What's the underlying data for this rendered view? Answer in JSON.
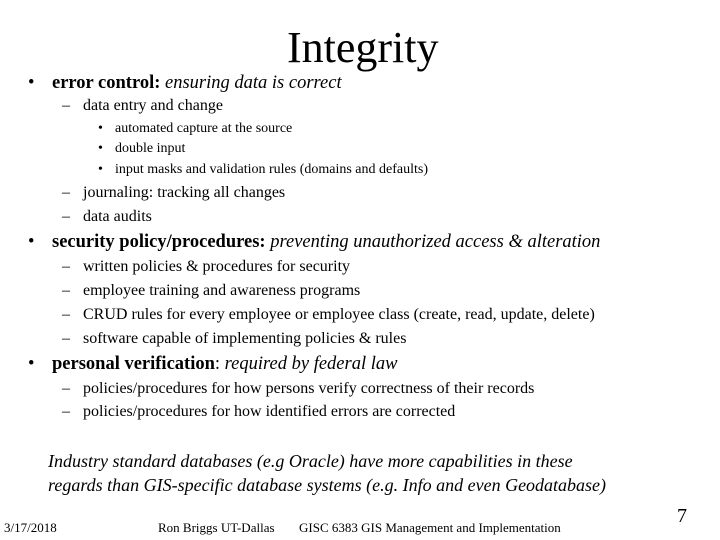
{
  "slide": {
    "title": "Integrity",
    "sections": [
      {
        "bullet": "•",
        "label": "error control:",
        "description": "ensuring data is correct",
        "items": [
          {
            "dash": "–",
            "text": "data entry and change",
            "subitems": [
              {
                "bullet": "•",
                "text": "automated capture at the source"
              },
              {
                "bullet": "•",
                "text": "double input"
              },
              {
                "bullet": "•",
                "text": "input masks and validation rules  (domains and defaults)"
              }
            ]
          },
          {
            "dash": "–",
            "text": "journaling: tracking all changes"
          },
          {
            "dash": "–",
            "text": "data audits"
          }
        ]
      },
      {
        "bullet": "•",
        "label": "security policy/procedures:",
        "description": "preventing  unauthorized access & alteration",
        "items": [
          {
            "dash": "–",
            "text": "written policies & procedures for security"
          },
          {
            "dash": "–",
            "text": "employee training and awareness programs"
          },
          {
            "dash": "–",
            "text": "CRUD rules for every employee or employee class (create, read, update, delete)"
          },
          {
            "dash": "–",
            "text": "software capable of implementing policies & rules"
          }
        ]
      },
      {
        "bullet": "•",
        "label": "personal verification",
        "label_suffix": ":",
        "description": "required by federal law",
        "items": [
          {
            "dash": "–",
            "text": "policies/procedures for how persons verify correctness of their records"
          },
          {
            "dash": "–",
            "text": "policies/procedures for how identified errors are  corrected"
          }
        ]
      }
    ],
    "note_lines": [
      "Industry standard databases (e.g Oracle) have more capabilities in these",
      "regards than GIS-specific database systems (e.g. Info and even Geodatabase)"
    ],
    "footer": {
      "date": "3/17/2018",
      "author": "Ron Briggs UT-Dallas",
      "course": "GISC 6383 GIS Management and Implementation",
      "page_number": "7"
    }
  }
}
